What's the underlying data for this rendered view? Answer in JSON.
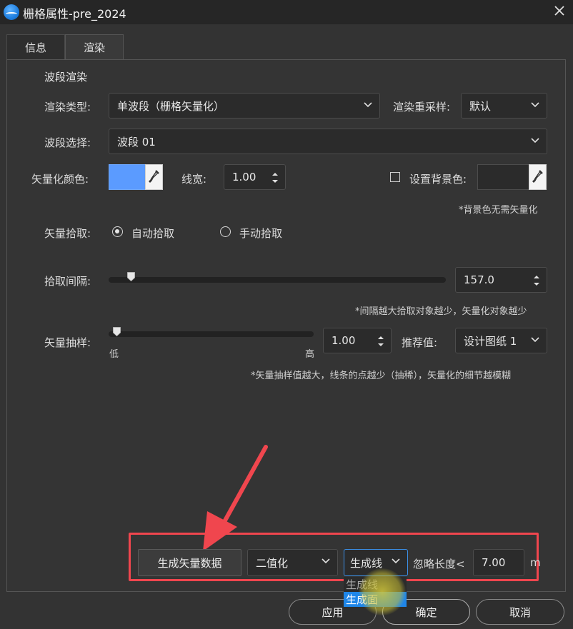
{
  "window": {
    "title": "栅格属性-pre_2024"
  },
  "tabs": [
    {
      "label": "信息"
    },
    {
      "label": "渲染"
    }
  ],
  "group": {
    "title": "波段渲染"
  },
  "render_type": {
    "label": "渲染类型:",
    "value": "单波段（栅格矢量化）"
  },
  "resample": {
    "label": "渲染重采样:",
    "value": "默认"
  },
  "band": {
    "label": "波段选择:",
    "value": "波段 01"
  },
  "vector_color": {
    "label": "矢量化颜色:",
    "color": "#5b9bff"
  },
  "line_width": {
    "label": "线宽:",
    "value": "1.00"
  },
  "background": {
    "label": "设置背景色:",
    "note": "*背景色无需矢量化",
    "checked": false
  },
  "pick": {
    "label": "矢量拾取:",
    "auto": "自动拾取",
    "manual": "手动拾取",
    "selected": "auto"
  },
  "interval": {
    "label": "拾取间隔:",
    "value": "157.0",
    "note": "*间隔越大拾取对象越少，矢量化对象越少"
  },
  "sampling": {
    "label": "矢量抽样:",
    "low": "低",
    "high": "高",
    "value": "1.00",
    "note": "*矢量抽样值越大，线条的点越少（抽稀），矢量化的细节越模糊"
  },
  "recommend": {
    "label": "推荐值:",
    "value": "设计图纸 1"
  },
  "action": {
    "generate_button": "生成矢量数据",
    "mode_value": "二值化",
    "output_value": "生成线",
    "output_options": [
      "生成线",
      "生成面"
    ],
    "ignore_label": "忽略长度<",
    "ignore_value": "7.00",
    "unit": "m"
  },
  "footer": {
    "apply": "应用",
    "ok": "确定",
    "cancel": "取消"
  },
  "colors": {
    "accent": "#1f86e8",
    "highlight": "#f0464e",
    "swatch": "#5b9bff"
  }
}
